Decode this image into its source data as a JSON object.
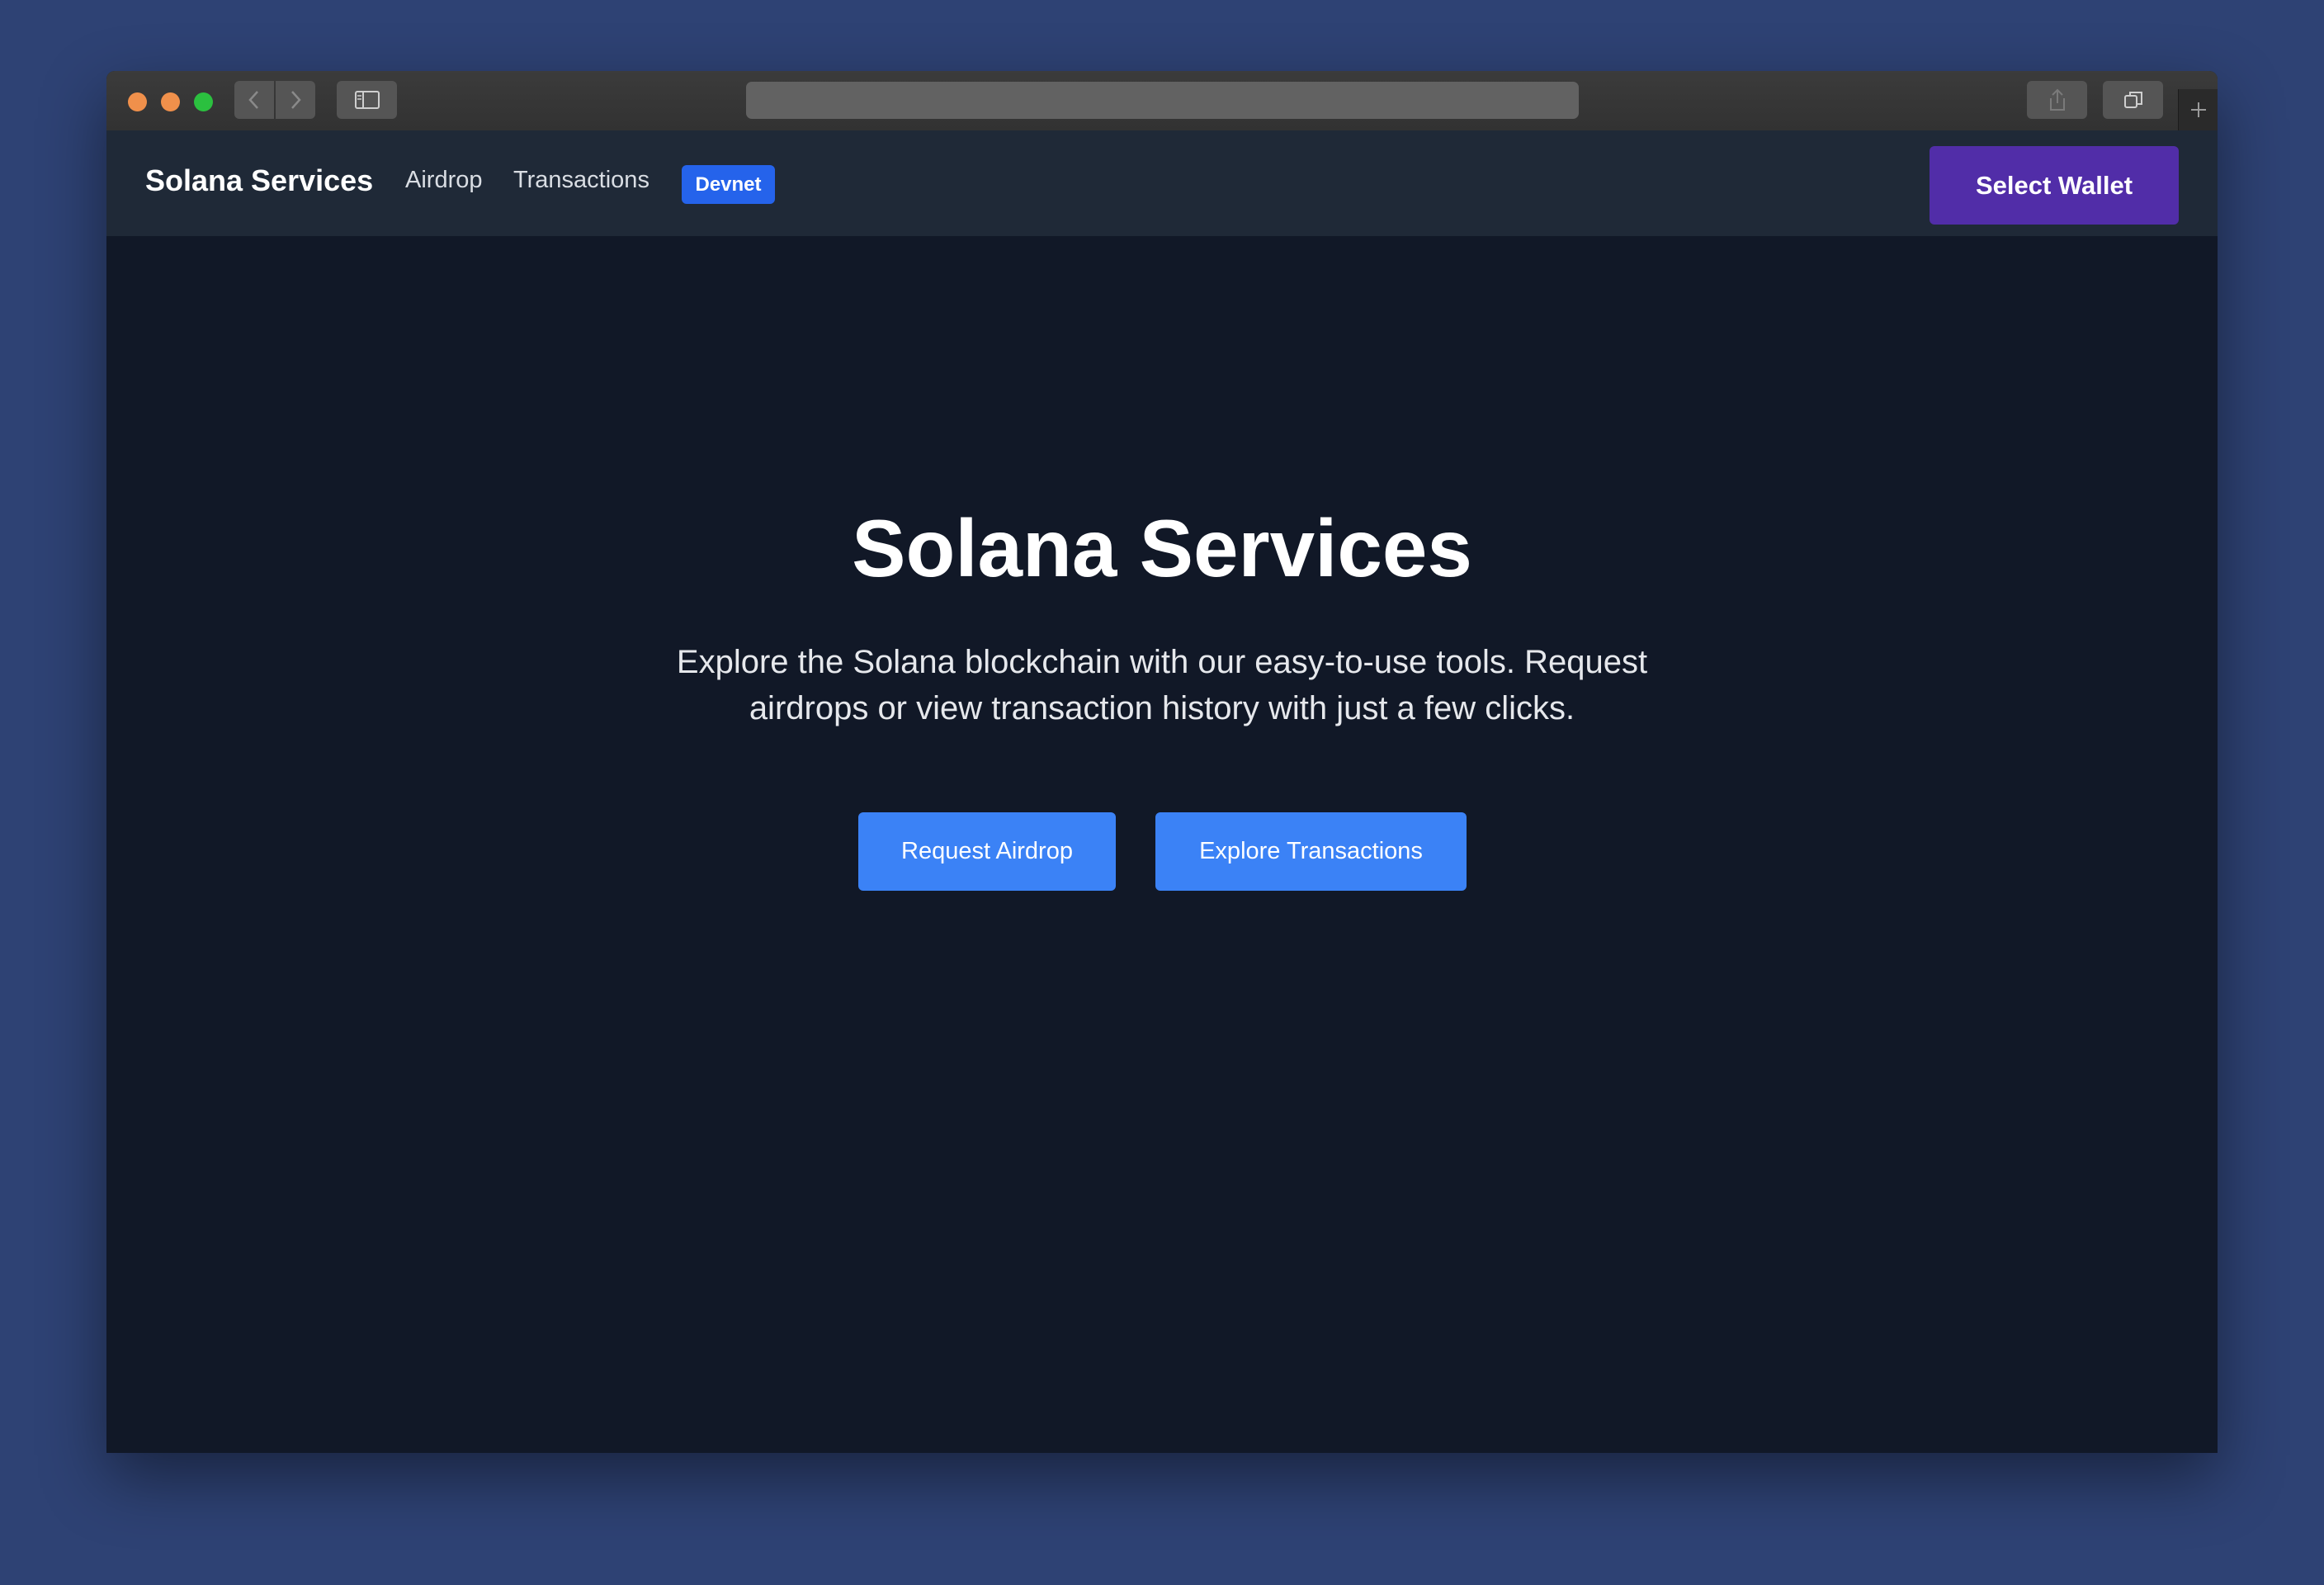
{
  "browser": {
    "url": ""
  },
  "nav": {
    "brand": "Solana Services",
    "links": [
      "Airdrop",
      "Transactions"
    ],
    "network_badge": "Devnet",
    "wallet_button": "Select Wallet"
  },
  "hero": {
    "title": "Solana Services",
    "description": "Explore the Solana blockchain with our easy-to-use tools. Request airdrops or view transaction history with just a few clicks.",
    "buttons": [
      "Request Airdrop",
      "Explore Transactions"
    ]
  },
  "colors": {
    "background": "#2e4274",
    "page": "#111827",
    "nav": "#1f2937",
    "badge": "#2563eb",
    "wallet": "#512da8",
    "cta": "#3b82f6"
  }
}
